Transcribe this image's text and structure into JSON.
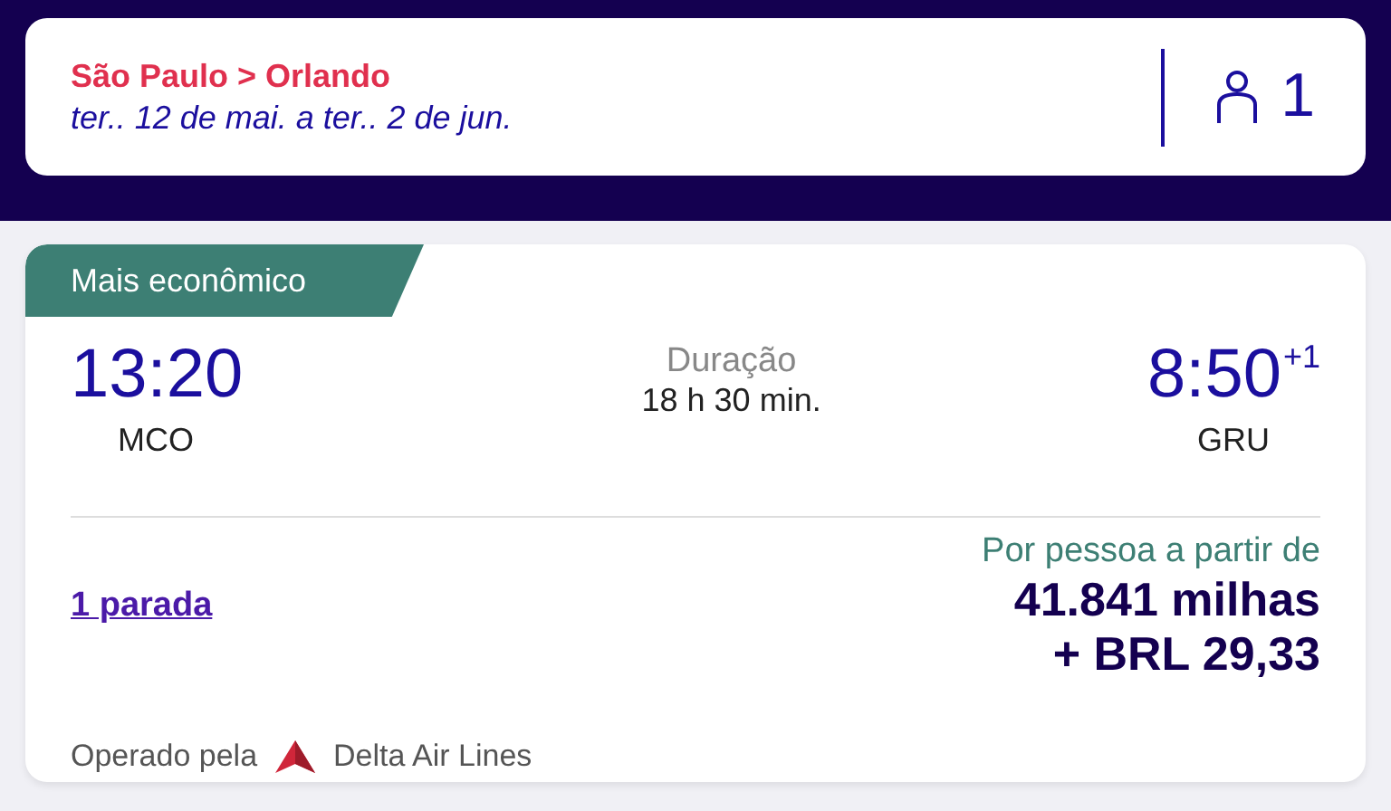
{
  "search": {
    "route": "São Paulo > Orlando",
    "dates": "ter.. 12 de mai. a ter.. 2 de jun.",
    "passengers": "1"
  },
  "result": {
    "badge": "Mais econômico",
    "departure": {
      "time": "13:20",
      "airport": "MCO"
    },
    "duration": {
      "label": "Duração",
      "value": "18 h 30 min."
    },
    "arrival": {
      "time": "8:50",
      "day_offset": "+1",
      "airport": "GRU"
    },
    "stops": "1 parada",
    "price": {
      "label": "Por pessoa a partir de",
      "miles": "41.841 milhas",
      "cash": "+ BRL 29,33"
    },
    "operator": {
      "label": "Operado pela",
      "airline": "Delta Air Lines"
    }
  }
}
